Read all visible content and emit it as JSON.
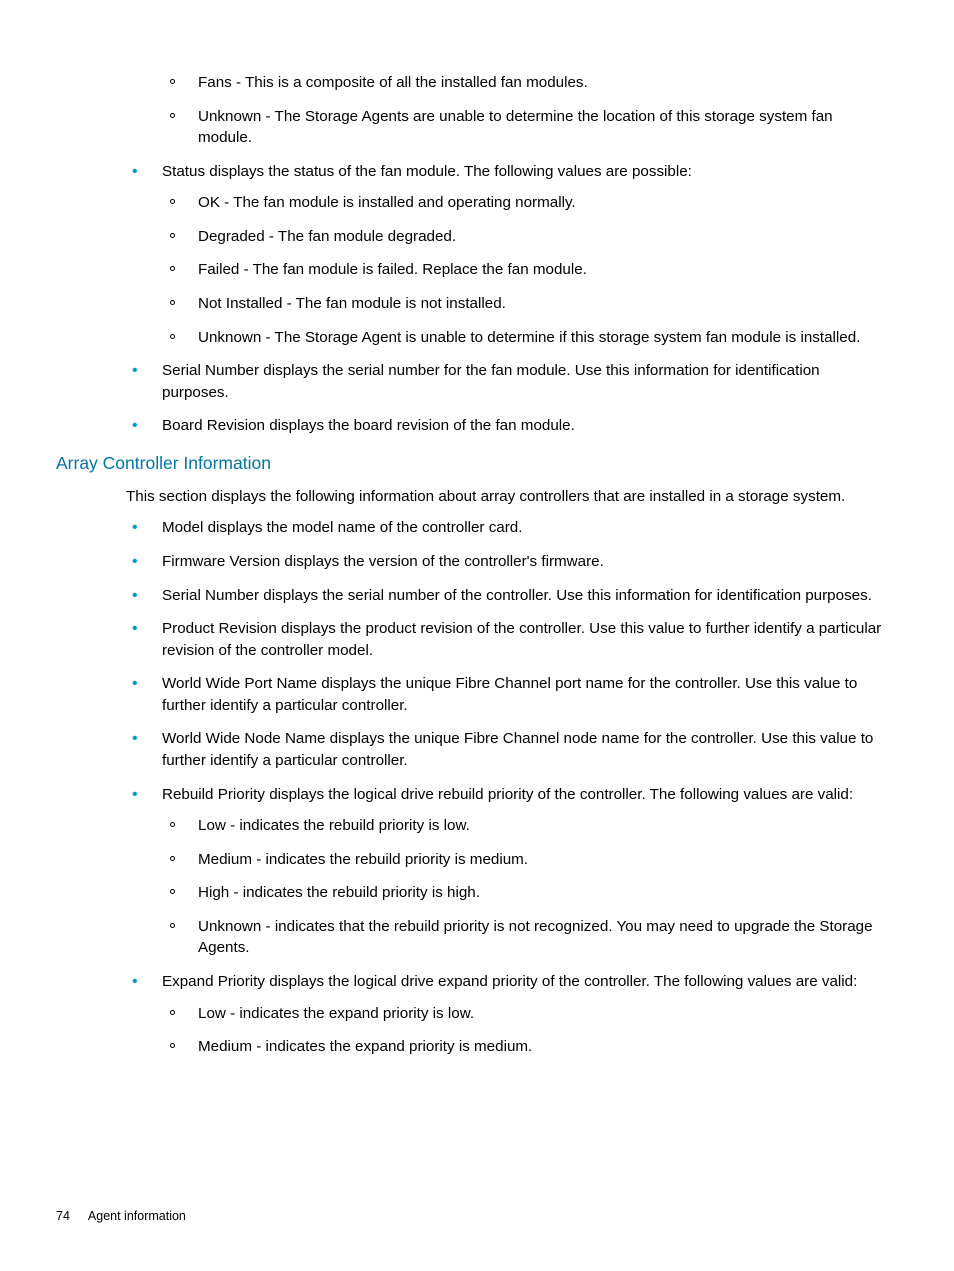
{
  "section1": {
    "pre_sub": [
      "Fans - This is a composite of all the installed fan modules.",
      "Unknown - The Storage Agents are unable to determine the location of this storage system fan module."
    ],
    "bullets": [
      {
        "text": "Status displays the status of the fan module. The following values are possible:",
        "sub": [
          "OK - The fan module is installed and operating normally.",
          "Degraded - The fan module degraded.",
          "Failed - The fan module is failed. Replace the fan module.",
          "Not Installed - The fan module is not installed.",
          "Unknown - The Storage Agent is unable to determine if this storage system fan module is installed."
        ]
      },
      {
        "text": "Serial Number displays the serial number for the fan module. Use this information for identification purposes."
      },
      {
        "text": "Board Revision displays the board revision of the fan module."
      }
    ]
  },
  "heading": "Array Controller Information",
  "section2": {
    "intro": "This section displays the following information about array controllers that are installed in a storage system.",
    "bullets": [
      {
        "text": "Model displays the model name of the controller card."
      },
      {
        "text": "Firmware Version displays the version of the controller's firmware."
      },
      {
        "text": "Serial Number displays the serial number of the controller. Use this information for identification purposes."
      },
      {
        "text": "Product Revision displays the product revision of the controller. Use this value to further identify a particular revision of the controller model."
      },
      {
        "text": "World Wide Port Name displays the unique Fibre Channel port name for the controller. Use this value to further identify a particular controller."
      },
      {
        "text": "World Wide Node Name displays the unique Fibre Channel node name for the controller. Use this value to further identify a particular controller."
      },
      {
        "text": "Rebuild Priority displays the logical drive rebuild priority of the controller. The following values are valid:",
        "sub": [
          "Low - indicates the rebuild priority is low.",
          "Medium - indicates the rebuild priority is medium.",
          "High - indicates the rebuild priority is high.",
          "Unknown - indicates that the rebuild priority is not recognized. You may need to upgrade the Storage Agents."
        ]
      },
      {
        "text": "Expand Priority displays the logical drive expand priority of the controller. The following values are valid:",
        "sub": [
          "Low - indicates the expand priority is low.",
          "Medium - indicates the expand priority is medium."
        ]
      }
    ]
  },
  "footer": {
    "page_number": "74",
    "title": "Agent information"
  }
}
